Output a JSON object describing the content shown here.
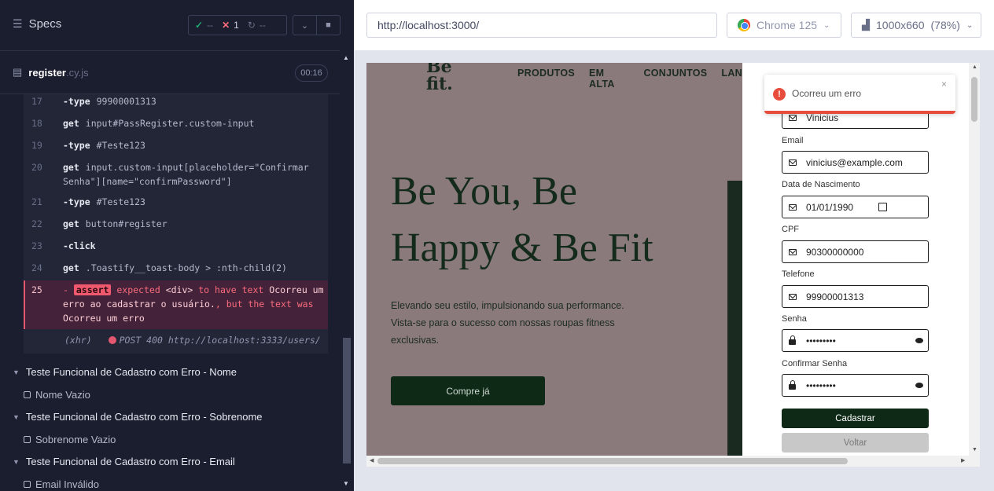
{
  "runner": {
    "specs_label": "Specs",
    "stats": {
      "passed": "--",
      "failed": "1",
      "pending": "--"
    },
    "file": {
      "name": "register",
      "ext": ".cy.js",
      "duration": "00:16"
    },
    "commands": [
      {
        "num": "17",
        "name": "-type",
        "arg": "99900001313"
      },
      {
        "num": "18",
        "name": "get",
        "arg": "input#PassRegister.custom-input"
      },
      {
        "num": "19",
        "name": "-type",
        "arg": "#Teste123"
      },
      {
        "num": "20",
        "name": "get",
        "arg": "input.custom-input[placeholder=\"Confirmar Senha\"][name=\"confirmPassword\"]"
      },
      {
        "num": "21",
        "name": "-type",
        "arg": "#Teste123"
      },
      {
        "num": "22",
        "name": "get",
        "arg": "button#register"
      },
      {
        "num": "23",
        "name": "-click",
        "arg": ""
      },
      {
        "num": "24",
        "name": "get",
        "arg": ".Toastify__toast-body > :nth-child(2)"
      }
    ],
    "error": {
      "num": "25",
      "prefix": "-",
      "tag": "assert",
      "p1": "expected",
      "w1": "<div>",
      "p2": "to have text",
      "w2": "Ocorreu um erro ao cadastrar o usuário.",
      "p3": ", but the text was",
      "w3": "Ocorreu um erro"
    },
    "xhr": {
      "label": "(xhr)",
      "text": "POST 400 http://localhost:3333/users/"
    },
    "suites": [
      {
        "title": "Teste Funcional de Cadastro com Erro - Nome",
        "test": "Nome Vazio"
      },
      {
        "title": "Teste Funcional de Cadastro com Erro - Sobrenome",
        "test": "Sobrenome Vazio"
      },
      {
        "title": "Teste Funcional de Cadastro com Erro - Email",
        "test": "Email Inválido"
      }
    ]
  },
  "browser": {
    "url": "http://localhost:3000/",
    "browser_name": "Chrome 125",
    "viewport": "1000x660",
    "zoom": "(78%)"
  },
  "site": {
    "logo_line1": "Be",
    "logo_line2": "fit.",
    "nav": [
      "PRODUTOS",
      "EM ALTA",
      "CONJUNTOS",
      "LAN"
    ],
    "headline_line1": "Be You, Be",
    "headline_line2": "Happy & Be Fit",
    "subtitle": "Elevando seu estilo, impulsionando sua performance. Vista-se para o sucesso com nossas roupas fitness exclusivas.",
    "cta": "Compre já",
    "form": {
      "name_value": "Vinicius",
      "email_label": "Email",
      "email_value": "vinicius@example.com",
      "birth_label": "Data de Nascimento",
      "birth_value": "01/01/1990",
      "cpf_label": "CPF",
      "cpf_value": "90300000000",
      "phone_label": "Telefone",
      "phone_value": "99900001313",
      "pass_label": "Senha",
      "pass_value": "•••••••••",
      "confirm_label": "Confirmar Senha",
      "confirm_value": "•••••••••",
      "submit": "Cadastrar",
      "back": "Voltar"
    },
    "toast": {
      "message": "Ocorreu um erro",
      "close": "×",
      "icon": "!"
    }
  },
  "colors": {
    "runner_bg": "#1b1e2e",
    "error_red": "#e45770",
    "brand_green": "#0e2a17",
    "hero_bg": "#8a7a7c",
    "toast_red": "#e74c3c"
  }
}
